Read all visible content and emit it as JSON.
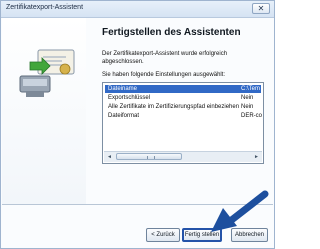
{
  "window": {
    "title": "Zertifikatexport-Assistent",
    "close_glyph": "✕"
  },
  "content": {
    "heading": "Fertigstellen des Assistenten",
    "intro": "Der Zertifikatexport-Assistent wurde erfolgreich abgeschlossen.",
    "settings_label": "Sie haben folgende Einstellungen ausgewählt:",
    "settings": [
      {
        "name": "Dateiname",
        "value": "C:\\Tem"
      },
      {
        "name": "Exportschlüssel",
        "value": "Nein"
      },
      {
        "name": "Alle Zertifikate im Zertifizierungspfad einbeziehen",
        "value": "Nein"
      },
      {
        "name": "Dateiformat",
        "value": "DER-co"
      }
    ],
    "scroll_left_glyph": "◄",
    "scroll_right_glyph": "►",
    "selection_color": "#3169c6"
  },
  "buttons": {
    "back": "< Zurück",
    "finish": "Fertig stellen",
    "cancel": "Abbrechen"
  },
  "annotation": {
    "arrow_color": "#1d4f9e"
  }
}
